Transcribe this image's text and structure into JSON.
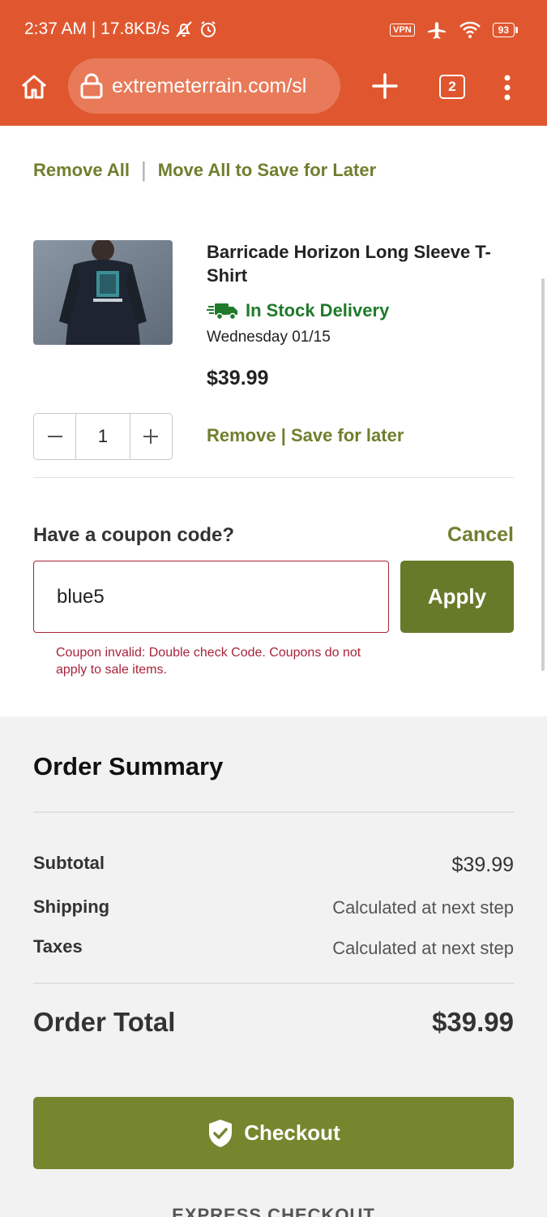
{
  "status_bar": {
    "time_speed": "2:37 AM | 17.8KB/s",
    "vpn": "VPN",
    "battery": "93"
  },
  "browser": {
    "url": "extremeterrain.com/sl",
    "tab_count": "2"
  },
  "cart": {
    "remove_all": "Remove All",
    "move_all": "Move All to Save for Later",
    "item": {
      "title": "Barricade Horizon Long Sleeve T-Shirt",
      "stock": "In Stock Delivery",
      "delivery_date": "Wednesday 01/15",
      "price": "$39.99",
      "quantity": "1",
      "remove": "Remove",
      "save_for_later": "Save for later",
      "separator": "|"
    }
  },
  "coupon": {
    "label": "Have a coupon code?",
    "cancel": "Cancel",
    "value": "blue5",
    "apply": "Apply",
    "error": "Coupon invalid: Double check Code. Coupons do not apply to sale items."
  },
  "summary": {
    "title": "Order Summary",
    "rows": [
      {
        "label": "Subtotal",
        "value": "$39.99"
      },
      {
        "label": "Shipping",
        "value": "Calculated at next step"
      },
      {
        "label": "Taxes",
        "value": "Calculated at next step"
      }
    ],
    "total_label": "Order Total",
    "total_value": "$39.99",
    "checkout": "Checkout",
    "express": "EXPRESS CHECKOUT"
  },
  "colors": {
    "header": "#e0572f",
    "accent_green": "#6f7f2e",
    "error": "#a8243a",
    "stock_green": "#1f7a2a"
  }
}
